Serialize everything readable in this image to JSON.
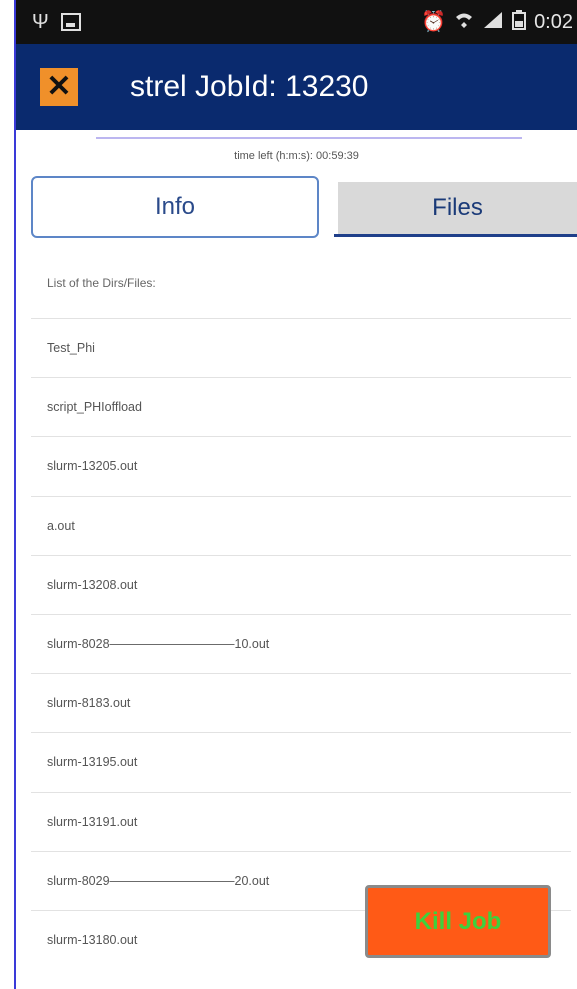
{
  "status_bar": {
    "time": "0:02",
    "icons": [
      "usb-icon",
      "image-icon",
      "alarm-icon",
      "wifi-icon",
      "signal-icon",
      "battery-icon"
    ]
  },
  "app_bar": {
    "close_icon": "✕",
    "title": "strel JobId: 13230",
    "background": "#0a2a6e",
    "close_color": "#f0902a"
  },
  "time_left": "time left (h:m:s): 00:59:39",
  "tabs": {
    "info": "Info",
    "files": "Files",
    "selected": "Files"
  },
  "list": {
    "header": "List of the Dirs/Files:",
    "items": [
      "Test_Phi",
      "script_PHIoffload",
      "slurm-13205.out",
      "a.out",
      "slurm-13208.out",
      "slurm-8028——————————10.out",
      "slurm-8183.out",
      "slurm-13195.out",
      "slurm-13191.out",
      "slurm-8029——————————20.out",
      "slurm-13180.out"
    ]
  },
  "kill_button": {
    "label": "Kill Job",
    "background": "#ff5a16",
    "text_color": "#3dd13d"
  }
}
